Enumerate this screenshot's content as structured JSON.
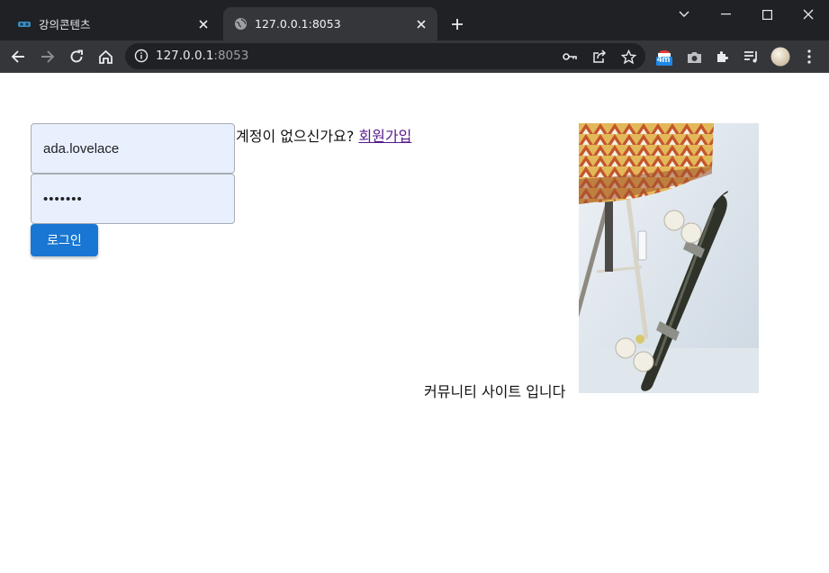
{
  "browser": {
    "tabs": [
      {
        "title": "강의콘텐츠",
        "icon": "course-favicon-icon",
        "active": false
      },
      {
        "title": "127.0.0.1:8053",
        "icon": "globe-icon",
        "active": true
      }
    ],
    "address": {
      "host": "127.0.0.1",
      "port": ":8053"
    },
    "extension_badge": "4m",
    "colors": {
      "frame": "#202124",
      "toolbar": "#35363a",
      "omnibox": "#202124"
    }
  },
  "login": {
    "username_value": "ada.lovelace",
    "password_value": "•••••••",
    "submit_label": "로그인"
  },
  "signup": {
    "prompt": "계정이 없으신가요? ",
    "link_label": "회원가입"
  },
  "community": {
    "caption": "커뮤니티 사이트 입니다"
  },
  "colors": {
    "button": "#1976d2",
    "autofill_field": "#e8f0fe",
    "visited_link": "#551a8b"
  }
}
